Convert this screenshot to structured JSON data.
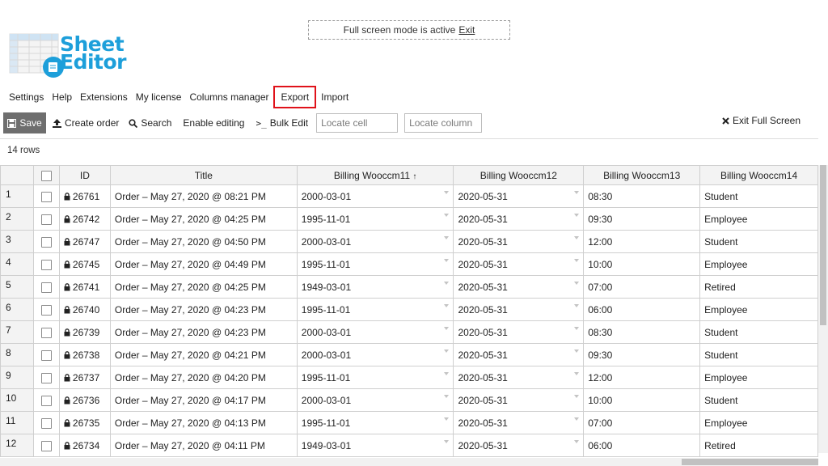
{
  "banner": {
    "text": "Full screen mode is active",
    "exit_label": "Exit"
  },
  "logo": {
    "line1": "Sheet",
    "line2": "Editor"
  },
  "menu": {
    "items": [
      "Settings",
      "Help",
      "Extensions",
      "My license",
      "Columns manager",
      "Export",
      "Import"
    ],
    "highlighted": "Export"
  },
  "toolbar": {
    "save_label": "Save",
    "create_order_label": "Create order",
    "search_label": "Search",
    "enable_editing_label": "Enable editing",
    "bulk_edit_label": "Bulk Edit",
    "locate_cell_placeholder": "Locate cell",
    "locate_column_placeholder": "Locate column",
    "exit_full_screen_label": "Exit Full Screen"
  },
  "rows_count": "14 rows",
  "table": {
    "headers": [
      "ID",
      "Title",
      "Billing Wooccm11",
      "Billing Wooccm12",
      "Billing Wooccm13",
      "Billing Wooccm14"
    ],
    "sort_indicator": "↑",
    "rows": [
      {
        "n": "1",
        "id": "26761",
        "title": "Order – May 27, 2020 @ 08:21 PM",
        "c11": "2000-03-01",
        "c12": "2020-05-31",
        "c13": "08:30",
        "c14": "Student"
      },
      {
        "n": "2",
        "id": "26742",
        "title": "Order – May 27, 2020 @ 04:25 PM",
        "c11": "1995-11-01",
        "c12": "2020-05-31",
        "c13": "09:30",
        "c14": "Employee"
      },
      {
        "n": "3",
        "id": "26747",
        "title": "Order – May 27, 2020 @ 04:50 PM",
        "c11": "2000-03-01",
        "c12": "2020-05-31",
        "c13": "12:00",
        "c14": "Student"
      },
      {
        "n": "4",
        "id": "26745",
        "title": "Order – May 27, 2020 @ 04:49 PM",
        "c11": "1995-11-01",
        "c12": "2020-05-31",
        "c13": "10:00",
        "c14": "Employee"
      },
      {
        "n": "5",
        "id": "26741",
        "title": "Order – May 27, 2020 @ 04:25 PM",
        "c11": "1949-03-01",
        "c12": "2020-05-31",
        "c13": "07:00",
        "c14": "Retired"
      },
      {
        "n": "6",
        "id": "26740",
        "title": "Order – May 27, 2020 @ 04:23 PM",
        "c11": "1995-11-01",
        "c12": "2020-05-31",
        "c13": "06:00",
        "c14": "Employee"
      },
      {
        "n": "7",
        "id": "26739",
        "title": "Order – May 27, 2020 @ 04:23 PM",
        "c11": "2000-03-01",
        "c12": "2020-05-31",
        "c13": "08:30",
        "c14": "Student"
      },
      {
        "n": "8",
        "id": "26738",
        "title": "Order – May 27, 2020 @ 04:21 PM",
        "c11": "2000-03-01",
        "c12": "2020-05-31",
        "c13": "09:30",
        "c14": "Student"
      },
      {
        "n": "9",
        "id": "26737",
        "title": "Order – May 27, 2020 @ 04:20 PM",
        "c11": "1995-11-01",
        "c12": "2020-05-31",
        "c13": "12:00",
        "c14": "Employee"
      },
      {
        "n": "10",
        "id": "26736",
        "title": "Order – May 27, 2020 @ 04:17 PM",
        "c11": "2000-03-01",
        "c12": "2020-05-31",
        "c13": "10:00",
        "c14": "Student"
      },
      {
        "n": "11",
        "id": "26735",
        "title": "Order – May 27, 2020 @ 04:13 PM",
        "c11": "1995-11-01",
        "c12": "2020-05-31",
        "c13": "07:00",
        "c14": "Employee"
      },
      {
        "n": "12",
        "id": "26734",
        "title": "Order – May 27, 2020 @ 04:11 PM",
        "c11": "1949-03-01",
        "c12": "2020-05-31",
        "c13": "06:00",
        "c14": "Retired"
      }
    ]
  },
  "colors": {
    "brand": "#1d9fda",
    "highlight": "#e0121a",
    "save_bg": "#6e6e6e"
  }
}
